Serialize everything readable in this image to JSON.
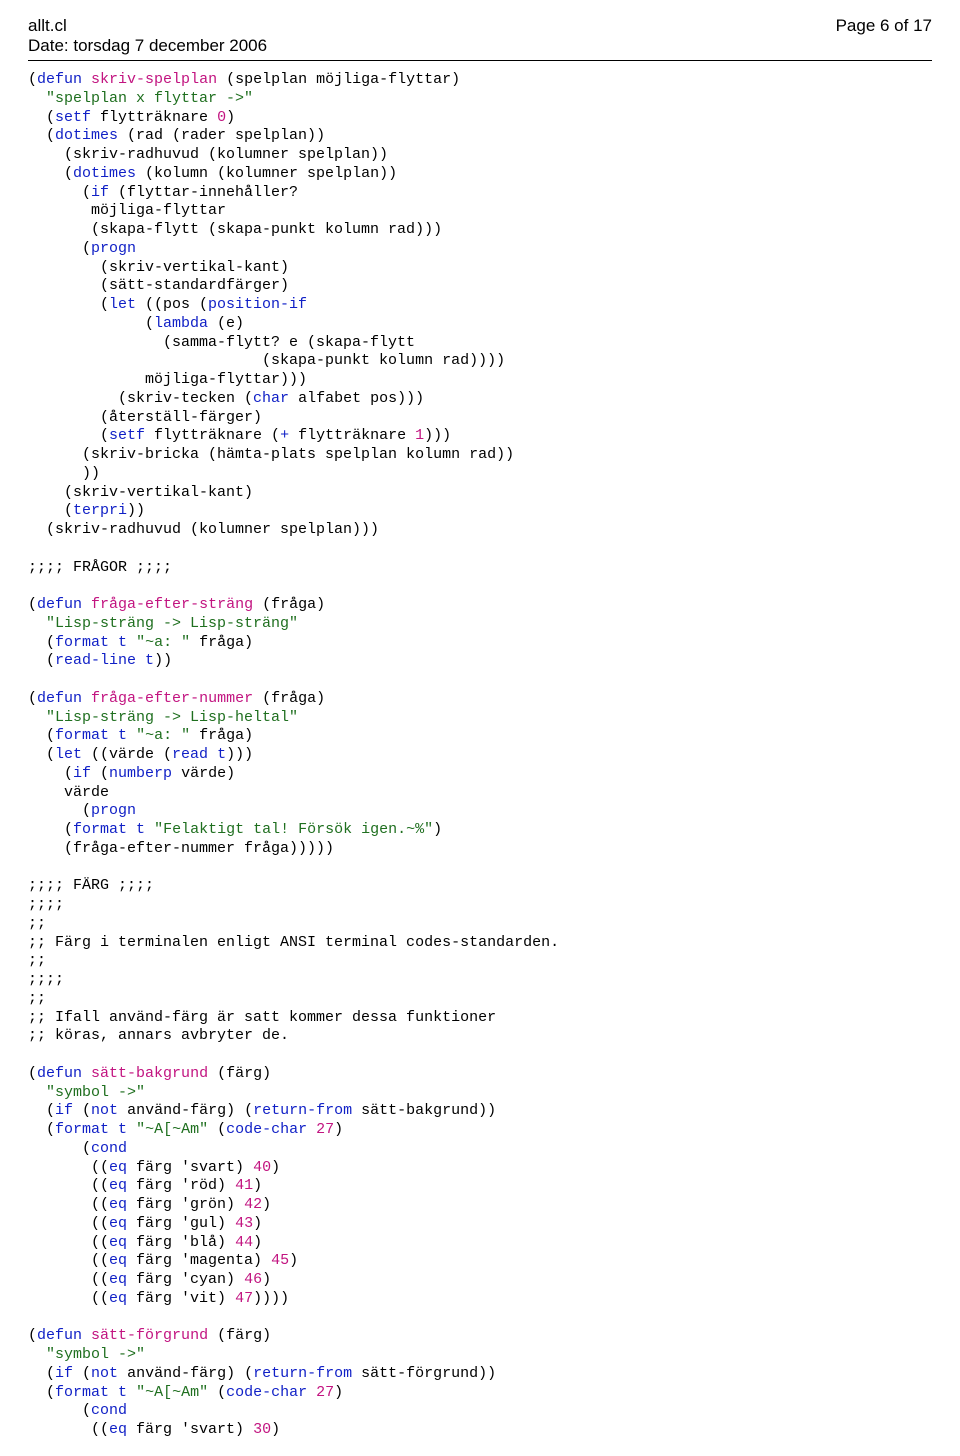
{
  "header": {
    "filename": "allt.cl",
    "date_line": "Date: torsdag 7 december 2006",
    "page_label": "Page 6 of 17"
  },
  "code": {
    "tokens": [
      [
        "(",
        "kw",
        "defun",
        " ",
        "fn",
        "skriv-spelplan",
        " (spelplan möjliga-flyttar)\n"
      ],
      [
        "  ",
        "str",
        "\"spelplan x flyttar ->\"",
        "\n"
      ],
      [
        "  (",
        "kw",
        "setf",
        " flytträknare ",
        "num",
        "0",
        ")\n"
      ],
      [
        "  (",
        "kw",
        "dotimes",
        " (rad (rader spelplan))\n"
      ],
      [
        "    (skriv-radhuvud (kolumner spelplan))\n"
      ],
      [
        "    (",
        "kw",
        "dotimes",
        " (kolumn (kolumner spelplan))\n"
      ],
      [
        "      (",
        "kw",
        "if",
        " (flyttar-innehåller?\n"
      ],
      [
        "       möjliga-flyttar\n"
      ],
      [
        "       (skapa-flytt (skapa-punkt kolumn rad)))\n"
      ],
      [
        "      (",
        "kw",
        "progn",
        "\n"
      ],
      [
        "        (skriv-vertikal-kant)\n"
      ],
      [
        "        (sätt-standardfärger)\n"
      ],
      [
        "        (",
        "kw",
        "let",
        " ((pos (",
        "kw",
        "position-if",
        "\n"
      ],
      [
        "             (",
        "kw",
        "lambda",
        " (e)\n"
      ],
      [
        "               (samma-flytt? e (skapa-flytt\n"
      ],
      [
        "                          (skapa-punkt kolumn rad))))\n"
      ],
      [
        "             möjliga-flyttar)))\n"
      ],
      [
        "          (skriv-tecken (",
        "kw",
        "char",
        " alfabet pos)))\n"
      ],
      [
        "        (återställ-färger)\n"
      ],
      [
        "        (",
        "kw",
        "setf",
        " flytträknare (",
        "kw",
        "+",
        " flytträknare ",
        "num",
        "1",
        ")))\n"
      ],
      [
        "      (skriv-bricka (hämta-plats spelplan kolumn rad))\n"
      ],
      [
        "      ))\n"
      ],
      [
        "    (skriv-vertikal-kant)\n"
      ],
      [
        "    (",
        "kw",
        "terpri",
        "))\n"
      ],
      [
        "  (skriv-radhuvud (kolumner spelplan)))\n"
      ],
      [
        "\n"
      ],
      [
        ";;;; FRÅGOR ;;;;\n"
      ],
      [
        "\n"
      ],
      [
        "(",
        "kw",
        "defun",
        " ",
        "fn",
        "fråga-efter-sträng",
        " (fråga)\n"
      ],
      [
        "  ",
        "str",
        "\"Lisp-sträng -> Lisp-sträng\"",
        "\n"
      ],
      [
        "  (",
        "kw",
        "format",
        " ",
        "kw",
        "t",
        " ",
        "str",
        "\"~a: \"",
        " fråga)\n"
      ],
      [
        "  (",
        "kw",
        "read-line",
        " ",
        "kw",
        "t",
        "))\n"
      ],
      [
        "\n"
      ],
      [
        "(",
        "kw",
        "defun",
        " ",
        "fn",
        "fråga-efter-nummer",
        " (fråga)\n"
      ],
      [
        "  ",
        "str",
        "\"Lisp-sträng -> Lisp-heltal\"",
        "\n"
      ],
      [
        "  (",
        "kw",
        "format",
        " ",
        "kw",
        "t",
        " ",
        "str",
        "\"~a: \"",
        " fråga)\n"
      ],
      [
        "  (",
        "kw",
        "let",
        " ((värde (",
        "kw",
        "read",
        " ",
        "kw",
        "t",
        ")))\n"
      ],
      [
        "    (",
        "kw",
        "if",
        " (",
        "kw",
        "numberp",
        " värde)\n"
      ],
      [
        "    värde\n"
      ],
      [
        "      (",
        "kw",
        "progn",
        "\n"
      ],
      [
        "    (",
        "kw",
        "format",
        " ",
        "kw",
        "t",
        " ",
        "str",
        "\"Felaktigt tal! Försök igen.~%\"",
        ")\n"
      ],
      [
        "    (fråga-efter-nummer fråga)))))\n"
      ],
      [
        "\n"
      ],
      [
        ";;;; FÄRG ;;;;\n"
      ],
      [
        ";;;;\n"
      ],
      [
        ";;\n"
      ],
      [
        ";; Färg i terminalen enligt ANSI terminal codes-standarden.\n"
      ],
      [
        ";;\n"
      ],
      [
        ";;;;\n"
      ],
      [
        ";;\n"
      ],
      [
        ";; Ifall använd-färg är satt kommer dessa funktioner\n"
      ],
      [
        ";; köras, annars avbryter de.\n"
      ],
      [
        "\n"
      ],
      [
        "(",
        "kw",
        "defun",
        " ",
        "fn",
        "sätt-bakgrund",
        " (färg)\n"
      ],
      [
        "  ",
        "str",
        "\"symbol ->\"",
        "\n"
      ],
      [
        "  (",
        "kw",
        "if",
        " (",
        "kw",
        "not",
        " använd-färg) (",
        "kw",
        "return-from",
        " sätt-bakgrund))\n"
      ],
      [
        "  (",
        "kw",
        "format",
        " ",
        "kw",
        "t",
        " ",
        "str",
        "\"~A[~Am\"",
        " (",
        "kw",
        "code-char",
        " ",
        "num",
        "27",
        ")\n"
      ],
      [
        "      (",
        "kw",
        "cond",
        "\n"
      ],
      [
        "       ((",
        "kw",
        "eq",
        " färg 'svart) ",
        "num",
        "40",
        ")\n"
      ],
      [
        "       ((",
        "kw",
        "eq",
        " färg 'röd) ",
        "num",
        "41",
        ")\n"
      ],
      [
        "       ((",
        "kw",
        "eq",
        " färg 'grön) ",
        "num",
        "42",
        ")\n"
      ],
      [
        "       ((",
        "kw",
        "eq",
        " färg 'gul) ",
        "num",
        "43",
        ")\n"
      ],
      [
        "       ((",
        "kw",
        "eq",
        " färg 'blå) ",
        "num",
        "44",
        ")\n"
      ],
      [
        "       ((",
        "kw",
        "eq",
        " färg 'magenta) ",
        "num",
        "45",
        ")\n"
      ],
      [
        "       ((",
        "kw",
        "eq",
        " färg 'cyan) ",
        "num",
        "46",
        ")\n"
      ],
      [
        "       ((",
        "kw",
        "eq",
        " färg 'vit) ",
        "num",
        "47",
        "))))\n"
      ],
      [
        "\n"
      ],
      [
        "(",
        "kw",
        "defun",
        " ",
        "fn",
        "sätt-förgrund",
        " (färg)\n"
      ],
      [
        "  ",
        "str",
        "\"symbol ->\"",
        "\n"
      ],
      [
        "  (",
        "kw",
        "if",
        " (",
        "kw",
        "not",
        " använd-färg) (",
        "kw",
        "return-from",
        " sätt-förgrund))\n"
      ],
      [
        "  (",
        "kw",
        "format",
        " ",
        "kw",
        "t",
        " ",
        "str",
        "\"~A[~Am\"",
        " (",
        "kw",
        "code-char",
        " ",
        "num",
        "27",
        ")\n"
      ],
      [
        "      (",
        "kw",
        "cond",
        "\n"
      ],
      [
        "       ((",
        "kw",
        "eq",
        " färg 'svart) ",
        "num",
        "30",
        ")\n"
      ]
    ]
  }
}
